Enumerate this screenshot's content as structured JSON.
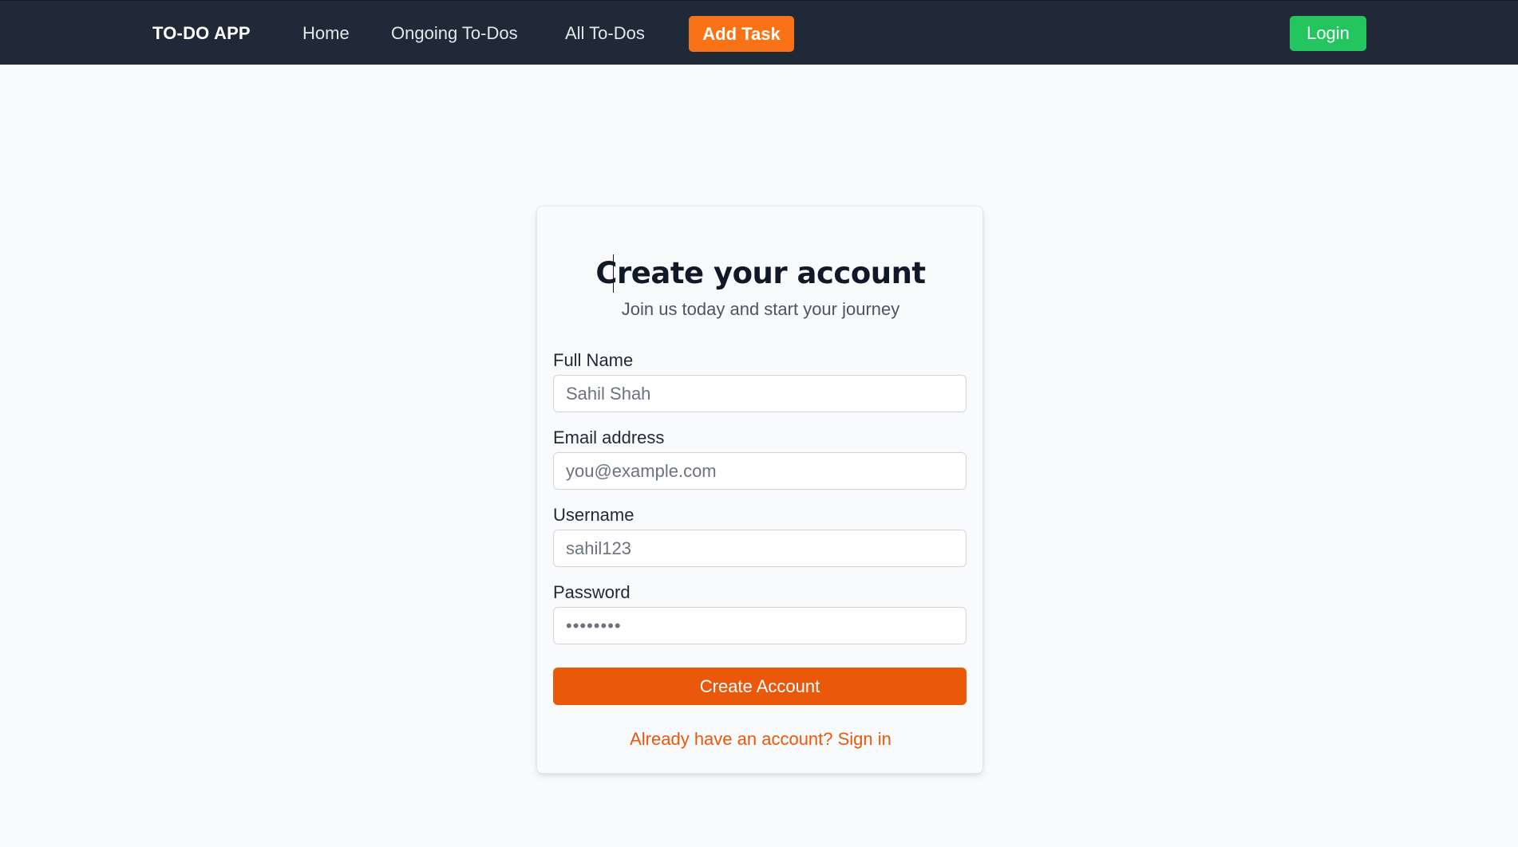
{
  "navbar": {
    "brand": "TO-DO APP",
    "links": [
      {
        "label": "Home"
      },
      {
        "label": "Ongoing To-Dos"
      },
      {
        "label": "All To-Dos"
      }
    ],
    "add_task_label": "Add Task",
    "login_label": "Login"
  },
  "form": {
    "title": "Create your account",
    "subtitle": "Join us today and start your journey",
    "fields": {
      "full_name": {
        "label": "Full Name",
        "placeholder": "Sahil Shah",
        "value": ""
      },
      "email": {
        "label": "Email address",
        "placeholder": "you@example.com",
        "value": ""
      },
      "username": {
        "label": "Username",
        "placeholder": "sahil123",
        "value": ""
      },
      "password": {
        "label": "Password",
        "placeholder": "••••••••",
        "value": ""
      }
    },
    "submit_label": "Create Account",
    "signin_text": "Already have an account? Sign in"
  },
  "colors": {
    "navbar_bg": "#1f2937",
    "accent_orange": "#f97316",
    "primary_orange": "#ea580c",
    "login_green": "#22c55e",
    "page_bg": "#f9fafb"
  }
}
